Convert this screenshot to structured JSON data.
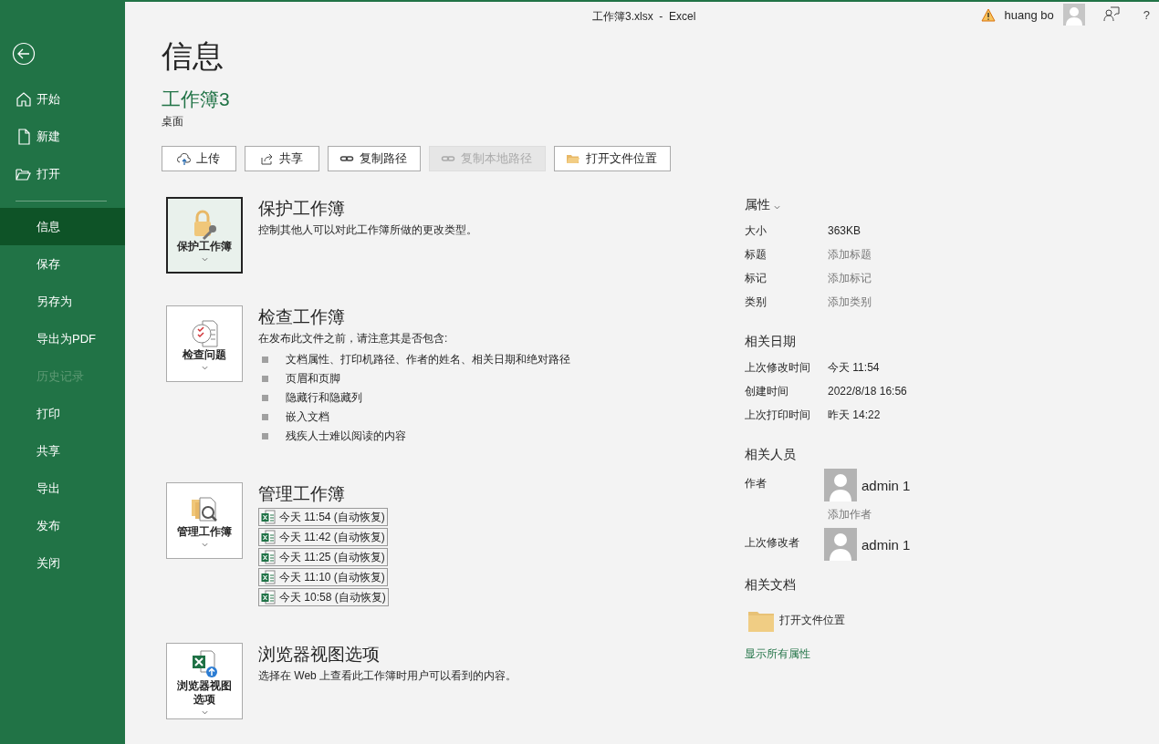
{
  "titlebar": {
    "title": "工作簿3.xlsx  -  Excel",
    "warning": true,
    "user": "huang bo",
    "help": "?"
  },
  "sidebar": {
    "top_items": [
      {
        "label": "开始"
      },
      {
        "label": "新建"
      },
      {
        "label": "打开"
      }
    ],
    "items": [
      {
        "label": "信息",
        "selected": true,
        "disabled": false
      },
      {
        "label": "保存",
        "selected": false,
        "disabled": false
      },
      {
        "label": "另存为",
        "selected": false,
        "disabled": false
      },
      {
        "label": "导出为PDF",
        "selected": false,
        "disabled": false
      },
      {
        "label": "历史记录",
        "selected": false,
        "disabled": true
      },
      {
        "label": "打印",
        "selected": false,
        "disabled": false
      },
      {
        "label": "共享",
        "selected": false,
        "disabled": false
      },
      {
        "label": "导出",
        "selected": false,
        "disabled": false
      },
      {
        "label": "发布",
        "selected": false,
        "disabled": false
      },
      {
        "label": "关闭",
        "selected": false,
        "disabled": false
      }
    ]
  },
  "page_title": "信息",
  "file_name": "工作簿3",
  "file_location": "桌面",
  "toolbar": [
    {
      "label": "上传",
      "disabled": false
    },
    {
      "label": "共享",
      "disabled": false
    },
    {
      "label": "复制路径",
      "disabled": false
    },
    {
      "label": "复制本地路径",
      "disabled": true
    },
    {
      "label": "打开文件位置",
      "disabled": false
    }
  ],
  "sections": [
    {
      "kind": "protect",
      "tile": "保护工作簿",
      "selected": true,
      "heading": "保护工作簿",
      "description": "控制其他人可以对此工作簿所做的更改类型。"
    },
    {
      "kind": "inspect",
      "tile": "检查问题",
      "selected": false,
      "heading": "检查工作簿",
      "description": "在发布此文件之前，请注意其是否包含:",
      "bullets": [
        "文档属性、打印机路径、作者的姓名、相关日期和绝对路径",
        "页眉和页脚",
        "隐藏行和隐藏列",
        "嵌入文档",
        "残疾人士难以阅读的内容"
      ]
    },
    {
      "kind": "manage",
      "tile": "管理工作簿",
      "selected": false,
      "heading": "管理工作簿",
      "versions": [
        "今天 11:54 (自动恢复)",
        "今天 11:42 (自动恢复)",
        "今天 11:25 (自动恢复)",
        "今天 11:10 (自动恢复)",
        "今天 10:58 (自动恢复)"
      ]
    },
    {
      "kind": "browser",
      "tile": "浏览器视图选项",
      "selected": false,
      "heading": "浏览器视图选项",
      "description": "选择在 Web 上查看此工作簿时用户可以看到的内容。"
    }
  ],
  "properties": {
    "heading": "属性",
    "rows": [
      {
        "label": "大小",
        "value": "363KB",
        "kind": "value"
      },
      {
        "label": "标题",
        "value": "添加标题",
        "kind": "link"
      },
      {
        "label": "标记",
        "value": "添加标记",
        "kind": "link"
      },
      {
        "label": "类别",
        "value": "添加类别",
        "kind": "link"
      }
    ]
  },
  "related_dates": {
    "heading": "相关日期",
    "rows": [
      {
        "label": "上次修改时间",
        "value": "今天 11:54"
      },
      {
        "label": "创建时间",
        "value": "2022/8/18 16:56"
      },
      {
        "label": "上次打印时间",
        "value": "昨天 14:22"
      }
    ]
  },
  "related_people": {
    "heading": "相关人员",
    "author_label": "作者",
    "author": "admin 1",
    "add_author": "添加作者",
    "modifier_label": "上次修改者",
    "modifier": "admin 1"
  },
  "related_documents": {
    "heading": "相关文档",
    "open_location": "打开文件位置"
  },
  "show_all": "显示所有属性"
}
